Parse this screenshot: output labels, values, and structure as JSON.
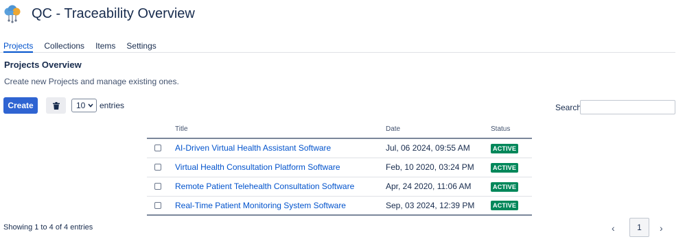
{
  "app": {
    "title": "QC - Traceability Overview",
    "logo_icon": "cloud-network-icon"
  },
  "tabs": [
    {
      "label": "Projects",
      "active": true
    },
    {
      "label": "Collections",
      "active": false
    },
    {
      "label": "Items",
      "active": false
    },
    {
      "label": "Settings",
      "active": false
    }
  ],
  "section": {
    "title": "Projects Overview",
    "description": "Create new Projects and manage existing ones."
  },
  "toolbar": {
    "create_label": "Create",
    "delete_icon": "trash-icon",
    "page_size": "10",
    "entries_label": "entries",
    "search_label": "Search",
    "search_value": ""
  },
  "table": {
    "headers": {
      "title": "Title",
      "date": "Date",
      "status": "Status"
    },
    "rows": [
      {
        "title": "AI-Driven Virtual Health Assistant Software",
        "date": "Jul, 06 2024, 09:55 AM",
        "status": "ACTIVE"
      },
      {
        "title": "Virtual Health Consultation Platform Software",
        "date": "Feb, 10 2020, 03:24 PM",
        "status": "ACTIVE"
      },
      {
        "title": "Remote Patient Telehealth Consultation Software",
        "date": "Apr, 24 2020, 11:06 AM",
        "status": "ACTIVE"
      },
      {
        "title": "Real-Time Patient Monitoring System Software",
        "date": "Sep, 03 2024, 12:39 PM",
        "status": "ACTIVE"
      }
    ]
  },
  "footer": {
    "showing": "Showing 1 to 4 of 4 entries",
    "prev": "‹",
    "page": "1",
    "next": "›"
  },
  "colors": {
    "accent": "#0052cc",
    "primary_button": "#2f64d2",
    "status_active": "#00875a"
  }
}
